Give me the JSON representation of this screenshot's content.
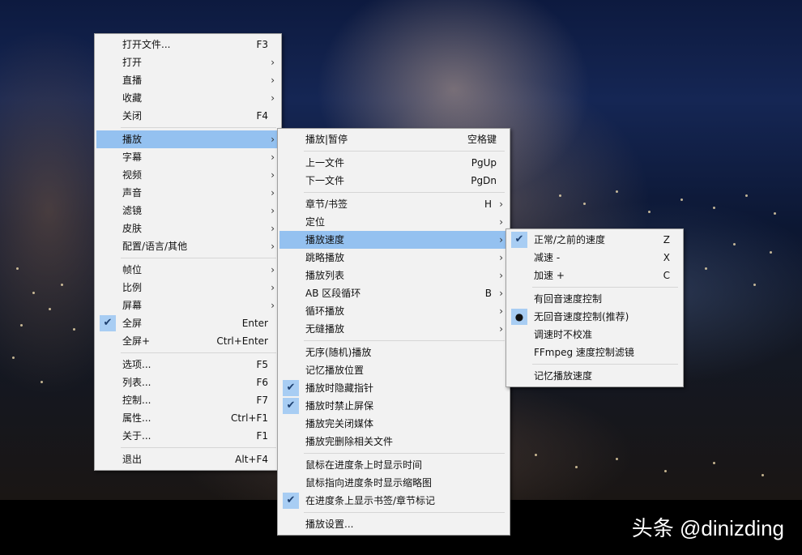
{
  "watermark": "头条 @dinizding",
  "menus": {
    "main": [
      {
        "label": "打开文件...",
        "shortcut": "F3"
      },
      {
        "label": "打开",
        "arrow": true
      },
      {
        "label": "直播",
        "arrow": true
      },
      {
        "label": "收藏",
        "arrow": true
      },
      {
        "label": "关闭",
        "shortcut": "F4"
      },
      {
        "sep": true
      },
      {
        "label": "播放",
        "arrow": true,
        "highlight": true
      },
      {
        "label": "字幕",
        "arrow": true
      },
      {
        "label": "视频",
        "arrow": true
      },
      {
        "label": "声音",
        "arrow": true
      },
      {
        "label": "滤镜",
        "arrow": true
      },
      {
        "label": "皮肤",
        "arrow": true
      },
      {
        "label": "配置/语言/其他",
        "arrow": true
      },
      {
        "sep": true
      },
      {
        "label": "帧位",
        "arrow": true
      },
      {
        "label": "比例",
        "arrow": true
      },
      {
        "label": "屏幕",
        "arrow": true
      },
      {
        "label": "全屏",
        "shortcut": "Enter",
        "check": true
      },
      {
        "label": "全屏+",
        "shortcut": "Ctrl+Enter"
      },
      {
        "sep": true
      },
      {
        "label": "选项...",
        "shortcut": "F5"
      },
      {
        "label": "列表...",
        "shortcut": "F6"
      },
      {
        "label": "控制...",
        "shortcut": "F7"
      },
      {
        "label": "属性...",
        "shortcut": "Ctrl+F1"
      },
      {
        "label": "关于...",
        "shortcut": "F1"
      },
      {
        "sep": true
      },
      {
        "label": "退出",
        "shortcut": "Alt+F4"
      }
    ],
    "play": [
      {
        "label": "播放|暂停",
        "shortcut": "空格键"
      },
      {
        "sep": true
      },
      {
        "label": "上一文件",
        "shortcut": "PgUp"
      },
      {
        "label": "下一文件",
        "shortcut": "PgDn"
      },
      {
        "sep": true
      },
      {
        "label": "章节/书签",
        "shortcut": "H",
        "arrow": true
      },
      {
        "label": "定位",
        "arrow": true
      },
      {
        "label": "播放速度",
        "arrow": true,
        "highlight": true
      },
      {
        "label": "跳略播放",
        "arrow": true
      },
      {
        "label": "播放列表",
        "arrow": true
      },
      {
        "label": "AB 区段循环",
        "shortcut": "B",
        "arrow": true
      },
      {
        "label": "循环播放",
        "arrow": true
      },
      {
        "label": "无缝播放",
        "arrow": true
      },
      {
        "sep": true
      },
      {
        "label": "无序(随机)播放"
      },
      {
        "label": "记忆播放位置"
      },
      {
        "label": "播放时隐藏指针",
        "check": true
      },
      {
        "label": "播放时禁止屏保",
        "check": true
      },
      {
        "label": "播放完关闭媒体"
      },
      {
        "label": "播放完删除相关文件"
      },
      {
        "sep": true
      },
      {
        "label": "鼠标在进度条上时显示时间"
      },
      {
        "label": "鼠标指向进度条时显示缩略图"
      },
      {
        "label": "在进度条上显示书签/章节标记",
        "check": true
      },
      {
        "sep": true
      },
      {
        "label": "播放设置..."
      }
    ],
    "speed": [
      {
        "label": "正常/之前的速度",
        "shortcut": "Z",
        "check": true
      },
      {
        "label": "减速 -",
        "shortcut": "X"
      },
      {
        "label": "加速 +",
        "shortcut": "C"
      },
      {
        "sep": true
      },
      {
        "label": "有回音速度控制"
      },
      {
        "label": "无回音速度控制(推荐)",
        "radio": true
      },
      {
        "label": "调速时不校准"
      },
      {
        "label": "FFmpeg 速度控制滤镜"
      },
      {
        "sep": true
      },
      {
        "label": "记忆播放速度"
      }
    ]
  },
  "icons": {
    "check": "checkmark-icon",
    "radio": "radio-dot-icon",
    "arrow": "chevron-right-icon"
  },
  "colors": {
    "highlight": "#94c1f0",
    "menu_bg": "#f2f2f2",
    "check_bg": "#a8cdf3"
  }
}
